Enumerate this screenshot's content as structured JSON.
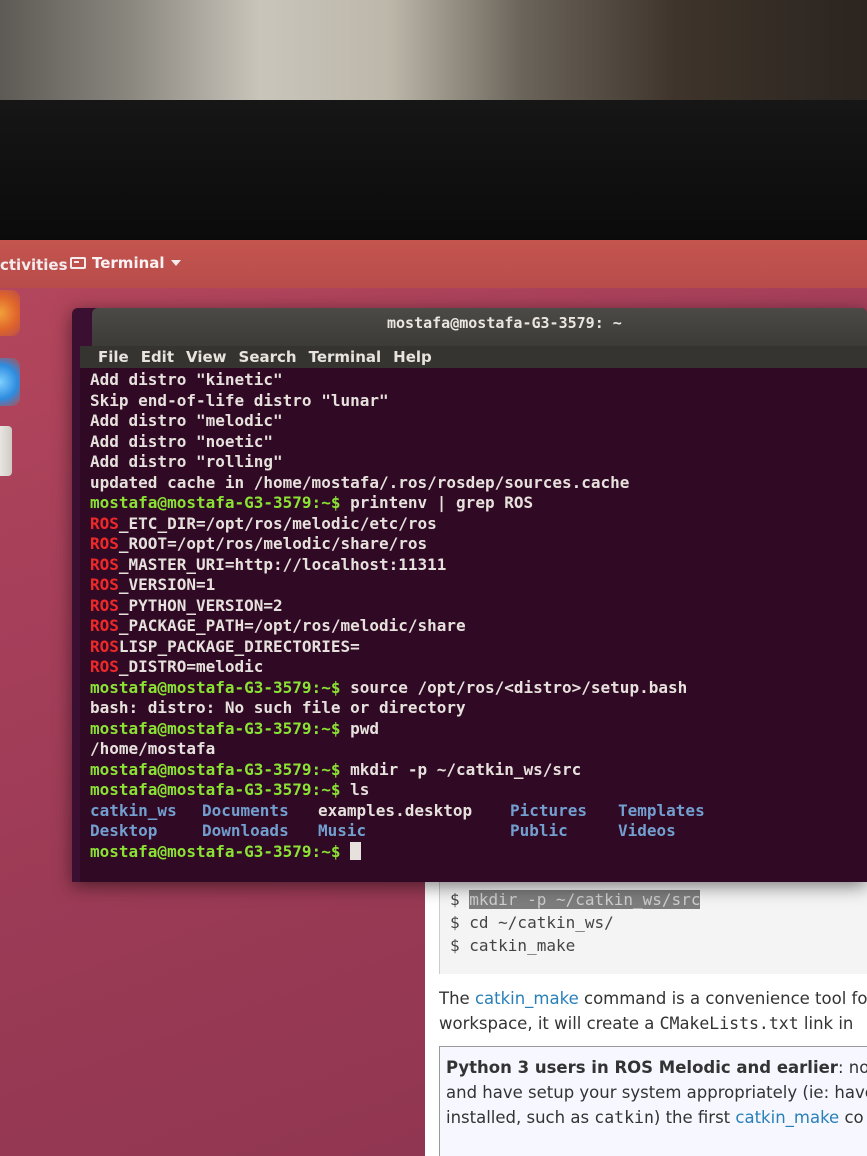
{
  "topbar": {
    "activities_label": "ctivities",
    "app_menu_label": "Terminal"
  },
  "terminal": {
    "title": "mostafa@mostafa-G3-3579: ~",
    "menu": [
      "File",
      "Edit",
      "View",
      "Search",
      "Terminal",
      "Help"
    ],
    "lines": [
      {
        "type": "out",
        "text": "Add distro \"kinetic\""
      },
      {
        "type": "out",
        "text": "Skip end-of-life distro \"lunar\""
      },
      {
        "type": "out",
        "text": "Add distro \"melodic\""
      },
      {
        "type": "out",
        "text": "Add distro \"noetic\""
      },
      {
        "type": "out",
        "text": "Add distro \"rolling\""
      },
      {
        "type": "out",
        "text": "updated cache in /home/mostafa/.ros/rosdep/sources.cache"
      },
      {
        "type": "cmd",
        "prompt": "mostafa@mostafa-G3-3579:~$",
        "text": " printenv | grep ROS"
      },
      {
        "type": "env",
        "key": "ROS",
        "text": "_ETC_DIR=/opt/ros/melodic/etc/ros"
      },
      {
        "type": "env",
        "key": "ROS",
        "text": "_ROOT=/opt/ros/melodic/share/ros"
      },
      {
        "type": "env",
        "key": "ROS",
        "text": "_MASTER_URI=http://localhost:11311"
      },
      {
        "type": "env",
        "key": "ROS",
        "text": "_VERSION=1"
      },
      {
        "type": "env",
        "key": "ROS",
        "text": "_PYTHON_VERSION=2"
      },
      {
        "type": "env",
        "key": "ROS",
        "text": "_PACKAGE_PATH=/opt/ros/melodic/share"
      },
      {
        "type": "env",
        "key": "ROS",
        "text": "LISP_PACKAGE_DIRECTORIES="
      },
      {
        "type": "env",
        "key": "ROS",
        "text": "_DISTRO=melodic"
      },
      {
        "type": "cmd",
        "prompt": "mostafa@mostafa-G3-3579:~$",
        "text": " source /opt/ros/<distro>/setup.bash"
      },
      {
        "type": "out",
        "text": "bash: distro: No such file or directory"
      },
      {
        "type": "cmd",
        "prompt": "mostafa@mostafa-G3-3579:~$",
        "text": " pwd"
      },
      {
        "type": "out",
        "text": "/home/mostafa"
      },
      {
        "type": "cmd",
        "prompt": "mostafa@mostafa-G3-3579:~$",
        "text": " mkdir -p ~/catkin_ws/src"
      },
      {
        "type": "cmd",
        "prompt": "mostafa@mostafa-G3-3579:~$",
        "text": " ls"
      }
    ],
    "ls_rows": [
      [
        {
          "text": "catkin_ws",
          "dir": true
        },
        {
          "text": "Documents",
          "dir": true
        },
        {
          "text": "examples.desktop",
          "dir": false
        },
        {
          "text": "Pictures",
          "dir": true
        },
        {
          "text": "Templates",
          "dir": true
        }
      ],
      [
        {
          "text": "Desktop",
          "dir": true
        },
        {
          "text": "Downloads",
          "dir": true
        },
        {
          "text": "Music",
          "dir": true
        },
        {
          "text": "Public",
          "dir": true
        },
        {
          "text": "Videos",
          "dir": true
        }
      ]
    ],
    "final_prompt": "mostafa@mostafa-G3-3579:~$"
  },
  "page": {
    "code_lines": [
      {
        "prefix": "$ ",
        "highlight": "mkdir -p ~/catkin_ws/src",
        "rest": ""
      },
      {
        "prefix": "$ ",
        "highlight": "",
        "rest": "cd ~/catkin_ws/"
      },
      {
        "prefix": "$ ",
        "highlight": "",
        "rest": "catkin_make"
      }
    ],
    "para_pre": "The ",
    "para_link": "catkin_make",
    "para_post": " command is a convenience tool fo",
    "para2_pre": "workspace, it will create a ",
    "para2_mono": "CMakeLists.txt",
    "para2_post": " link in",
    "note_bold": "Python 3 users in ROS Melodic and earlier",
    "note_rest": ": note",
    "note_line2": "and have setup your system appropriately (ie: have",
    "note_line3_pre": "installed, such as ",
    "note_line3_mono": "catkin",
    "note_line3_mid": ") the first ",
    "note_line3_link": "catkin_make",
    "note_line3_post": " co"
  },
  "colors": {
    "prompt": "#8ae234",
    "ros_key": "#ef2929",
    "directory": "#729fcf",
    "terminal_bg": "#300a24",
    "desktop_accent": "#b84c4b"
  }
}
